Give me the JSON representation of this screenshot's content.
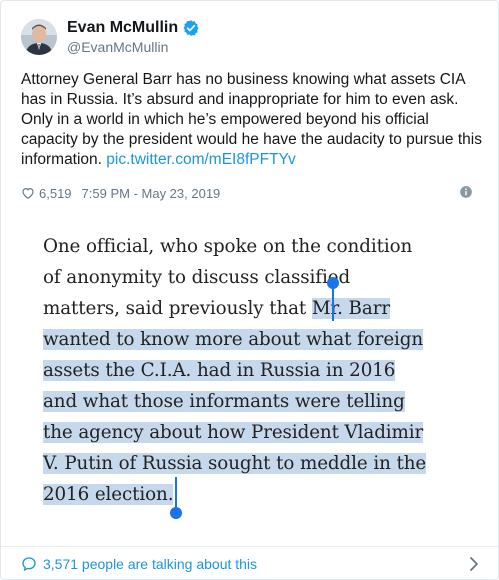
{
  "user": {
    "display_name": "Evan McMullin",
    "handle": "@EvanMcMullin"
  },
  "tweet": {
    "text": "Attorney General Barr has no business knowing what assets CIA has in Russia. It’s absurd and inappropriate for him to even ask. Only in a world in which he’s empowered beyond his official capacity by the president would he have the audacity to pursue this information. ",
    "link": "pic.twitter.com/mEI8fPFTYv",
    "likes": "6,519",
    "timestamp": "7:59 PM - May 23, 2019"
  },
  "quote": {
    "line1": "One official, who spoke on the condition",
    "line2": "of anonymity to discuss classified",
    "line3_pre": "matters, said previously that ",
    "line3_hl": "Mr. Barr",
    "line4": "wanted to know more about what foreign",
    "line5": "assets the C.I.A. had in Russia in 2016",
    "line6": "and what those informants were telling",
    "line7": "the agency about how President Vladimir",
    "line8": "V. Putin of Russia sought to meddle in the",
    "line9": "2016 election."
  },
  "footer": {
    "talking": "3,571 people are talking about this"
  },
  "icons": {
    "verified": "verified-badge-icon",
    "heart": "heart-icon",
    "info": "info-icon",
    "bubble": "speech-bubble-icon",
    "chevron": "chevron-right-icon"
  },
  "colors": {
    "link": "#1b95e0",
    "highlight": "#c6d9ec",
    "caret": "#1a73e8"
  }
}
